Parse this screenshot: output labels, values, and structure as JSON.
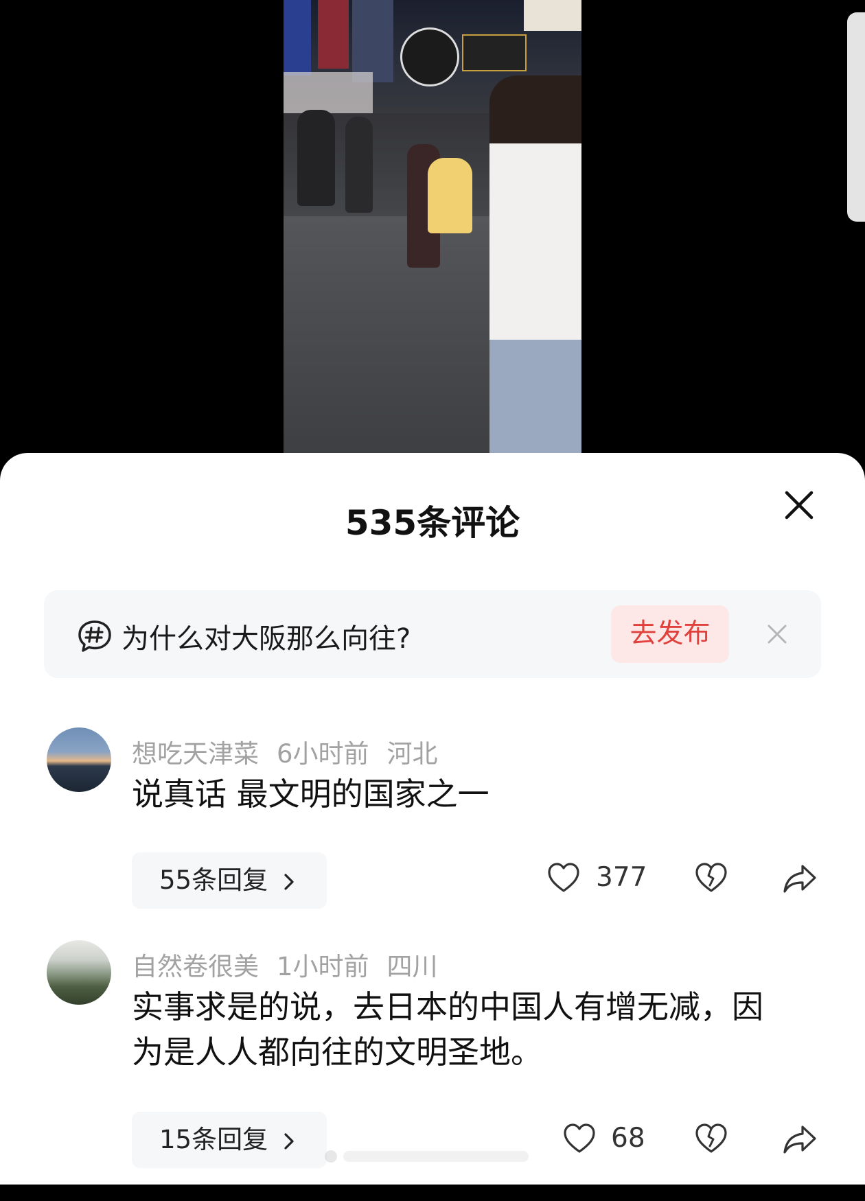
{
  "sheet": {
    "title": "535条评论",
    "topic": {
      "text": "为什么对大阪那么向往?",
      "publish_label": "去发布"
    }
  },
  "comments": [
    {
      "username": "想吃天津菜",
      "time": "6小时前",
      "location": "河北",
      "text": "说真话 最文明的国家之一",
      "replies_label": "55条回复",
      "likes": "377"
    },
    {
      "username": "自然卷很美",
      "time": "1小时前",
      "location": "四川",
      "text": "实事求是的说，去日本的中国人有增无减，因为是人人都向往的文明圣地。",
      "replies_label": "15条回复",
      "likes": "68"
    }
  ],
  "icons": [
    "close-icon",
    "topic-hash-icon",
    "dismiss-icon",
    "heart-icon",
    "broken-heart-icon",
    "share-icon",
    "chevron-right-icon"
  ]
}
